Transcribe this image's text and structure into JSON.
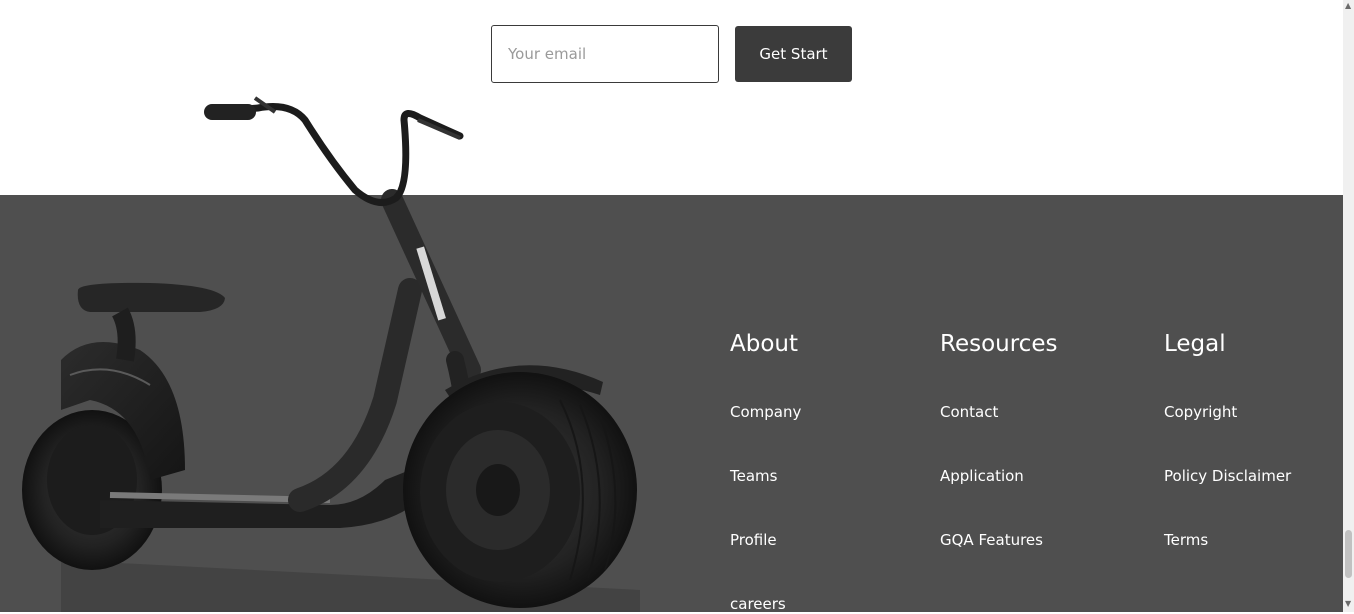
{
  "signup": {
    "email_placeholder": "Your email",
    "button_label": "Get Start"
  },
  "footer": {
    "about": {
      "title": "About",
      "links": [
        "Company",
        "Teams",
        "Profile",
        "careers"
      ]
    },
    "resources": {
      "title": "Resources",
      "links": [
        "Contact",
        "Application",
        "GQA Features"
      ]
    },
    "legal": {
      "title": "Legal",
      "links": [
        "Copyright",
        "Policy Disclaimer",
        "Terms"
      ]
    }
  },
  "colors": {
    "footer_bg": "#4f4f4f",
    "button_bg": "#3b3b3b",
    "page_bg": "#ffffff"
  },
  "icons": {
    "scooter": "electric-scooter-image",
    "scroll_up": "triangle-up",
    "scroll_down": "triangle-down"
  }
}
